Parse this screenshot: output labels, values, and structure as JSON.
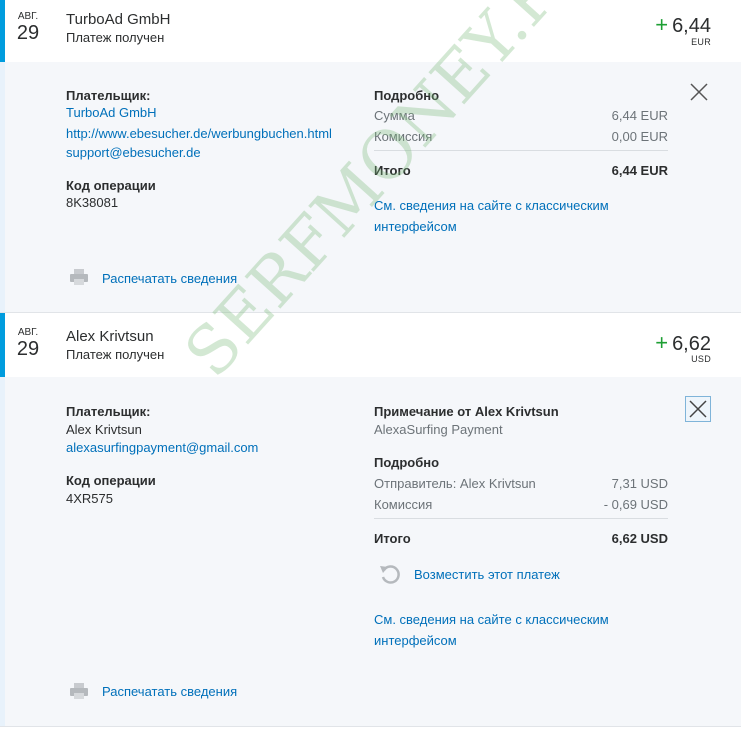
{
  "transactions": [
    {
      "month": "АВГ.",
      "day": "29",
      "party": "TurboAd GmbH",
      "status": "Платеж получен",
      "amount": "6,44",
      "currency": "EUR",
      "details": {
        "payer_label": "Плательщик:",
        "payer_name": "TurboAd GmbH",
        "payer_url": "http://www.ebesucher.de/werbungbuchen.html",
        "payer_email": "support@ebesucher.de",
        "op_code_label": "Код операции",
        "op_code": "8K38081",
        "detail_title": "Подробно",
        "sum_label": "Сумма",
        "sum_value": "6,44 EUR",
        "fee_label": "Комиссия",
        "fee_value": "0,00 EUR",
        "total_label": "Итого",
        "total_value": "6,44 EUR",
        "classic_link": [
          "См. сведения на сайте с классическим",
          "интерфейсом"
        ],
        "print_label": "Распечатать сведения"
      }
    },
    {
      "month": "АВГ.",
      "day": "29",
      "party": "Alex Krivtsun",
      "status": "Платеж получен",
      "amount": "6,62",
      "currency": "USD",
      "details": {
        "payer_label": "Плательщик:",
        "payer_name": "Alex Krivtsun",
        "payer_email": "alexasurfingpayment@gmail.com",
        "op_code_label": "Код операции",
        "op_code": "4XR575",
        "note_title": "Примечание от Alex Krivtsun",
        "note_text": "AlexaSurfing Payment",
        "detail_title": "Подробно",
        "sender_label": "Отправитель: Alex Krivtsun",
        "sender_value": "7,31 USD",
        "fee_label": "Комиссия",
        "fee_value": "- 0,69 USD",
        "total_label": "Итого",
        "total_value": "6,62 USD",
        "refund_label": "Возместить этот платеж",
        "classic_link": [
          "См. сведения на сайте с классическим",
          "интерфейсом"
        ],
        "print_label": "Распечатать сведения"
      }
    }
  ],
  "watermark": "SERFMONEY.RU",
  "colors": {
    "accent": "#009cde",
    "link": "#0070ba",
    "plus": "#1e9f34"
  }
}
